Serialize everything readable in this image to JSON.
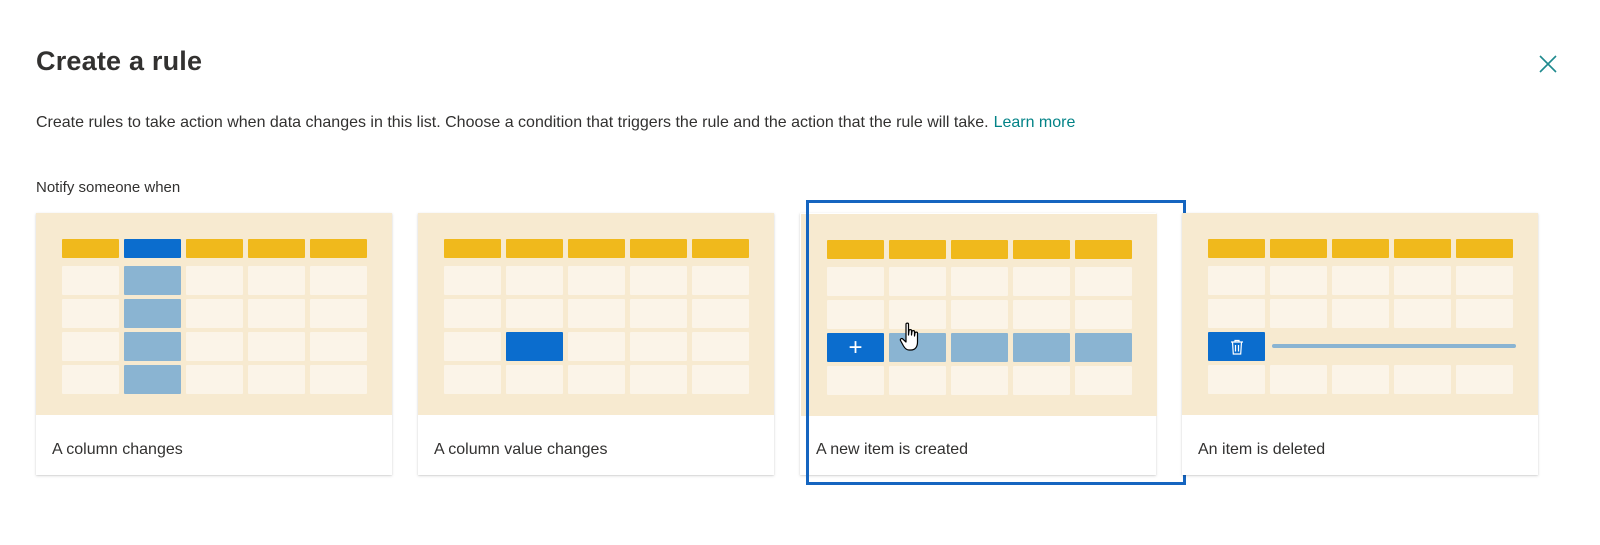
{
  "dialog": {
    "title": "Create a rule",
    "description": "Create rules to take action when data changes in this list. Choose a condition that triggers the rule and the action that the rule will take.",
    "learn_more": "Learn more",
    "section_label": "Notify someone when",
    "close_icon": "close-icon"
  },
  "cards": [
    {
      "label": "A column changes",
      "illustration": "column-highlighted"
    },
    {
      "label": "A column value changes",
      "illustration": "single-cell-highlighted"
    },
    {
      "label": "A new item is created",
      "illustration": "row-added",
      "selected": true
    },
    {
      "label": "An item is deleted",
      "illustration": "row-deleted"
    }
  ],
  "colors": {
    "accent_link": "#038387",
    "header_yellow": "#f0b91c",
    "primary_blue": "#0b6dce",
    "highlight_blue": "#8ab4d2",
    "illustration_bg": "#f7ead0",
    "selection_ring": "#1565c0"
  }
}
